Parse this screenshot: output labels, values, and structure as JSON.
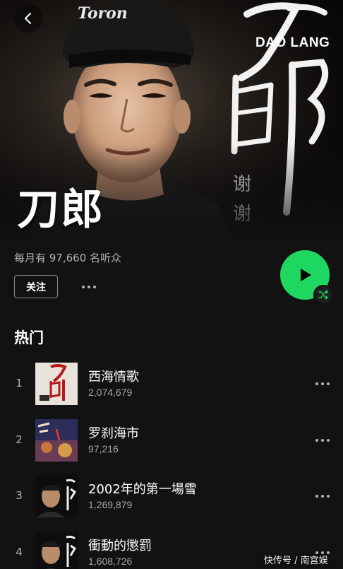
{
  "hero": {
    "artist_name": "刀郎",
    "brand_en": "DAO LANG",
    "cap_text": "Toron",
    "thanks": "谢谢"
  },
  "info": {
    "monthly_listeners": "每月有 97,660 名听众",
    "follow_label": "关注"
  },
  "popular": {
    "title": "热门",
    "tracks": [
      {
        "rank": "1",
        "title": "西海情歌",
        "plays": "2,074,679"
      },
      {
        "rank": "2",
        "title": "罗刹海市",
        "plays": "97,216"
      },
      {
        "rank": "3",
        "title": "2002年的第一場雪",
        "plays": "1,269,879"
      },
      {
        "rank": "4",
        "title": "衝動的懲罰",
        "plays": "1,608,726"
      }
    ]
  },
  "watermark": "快传号 / 南宫娱",
  "colors": {
    "accent": "#1ed760",
    "background": "#121212",
    "secondary_text": "#b3b3b3"
  },
  "icons": [
    "back-chevron-icon",
    "more-dots-icon",
    "play-icon",
    "shuffle-icon"
  ]
}
